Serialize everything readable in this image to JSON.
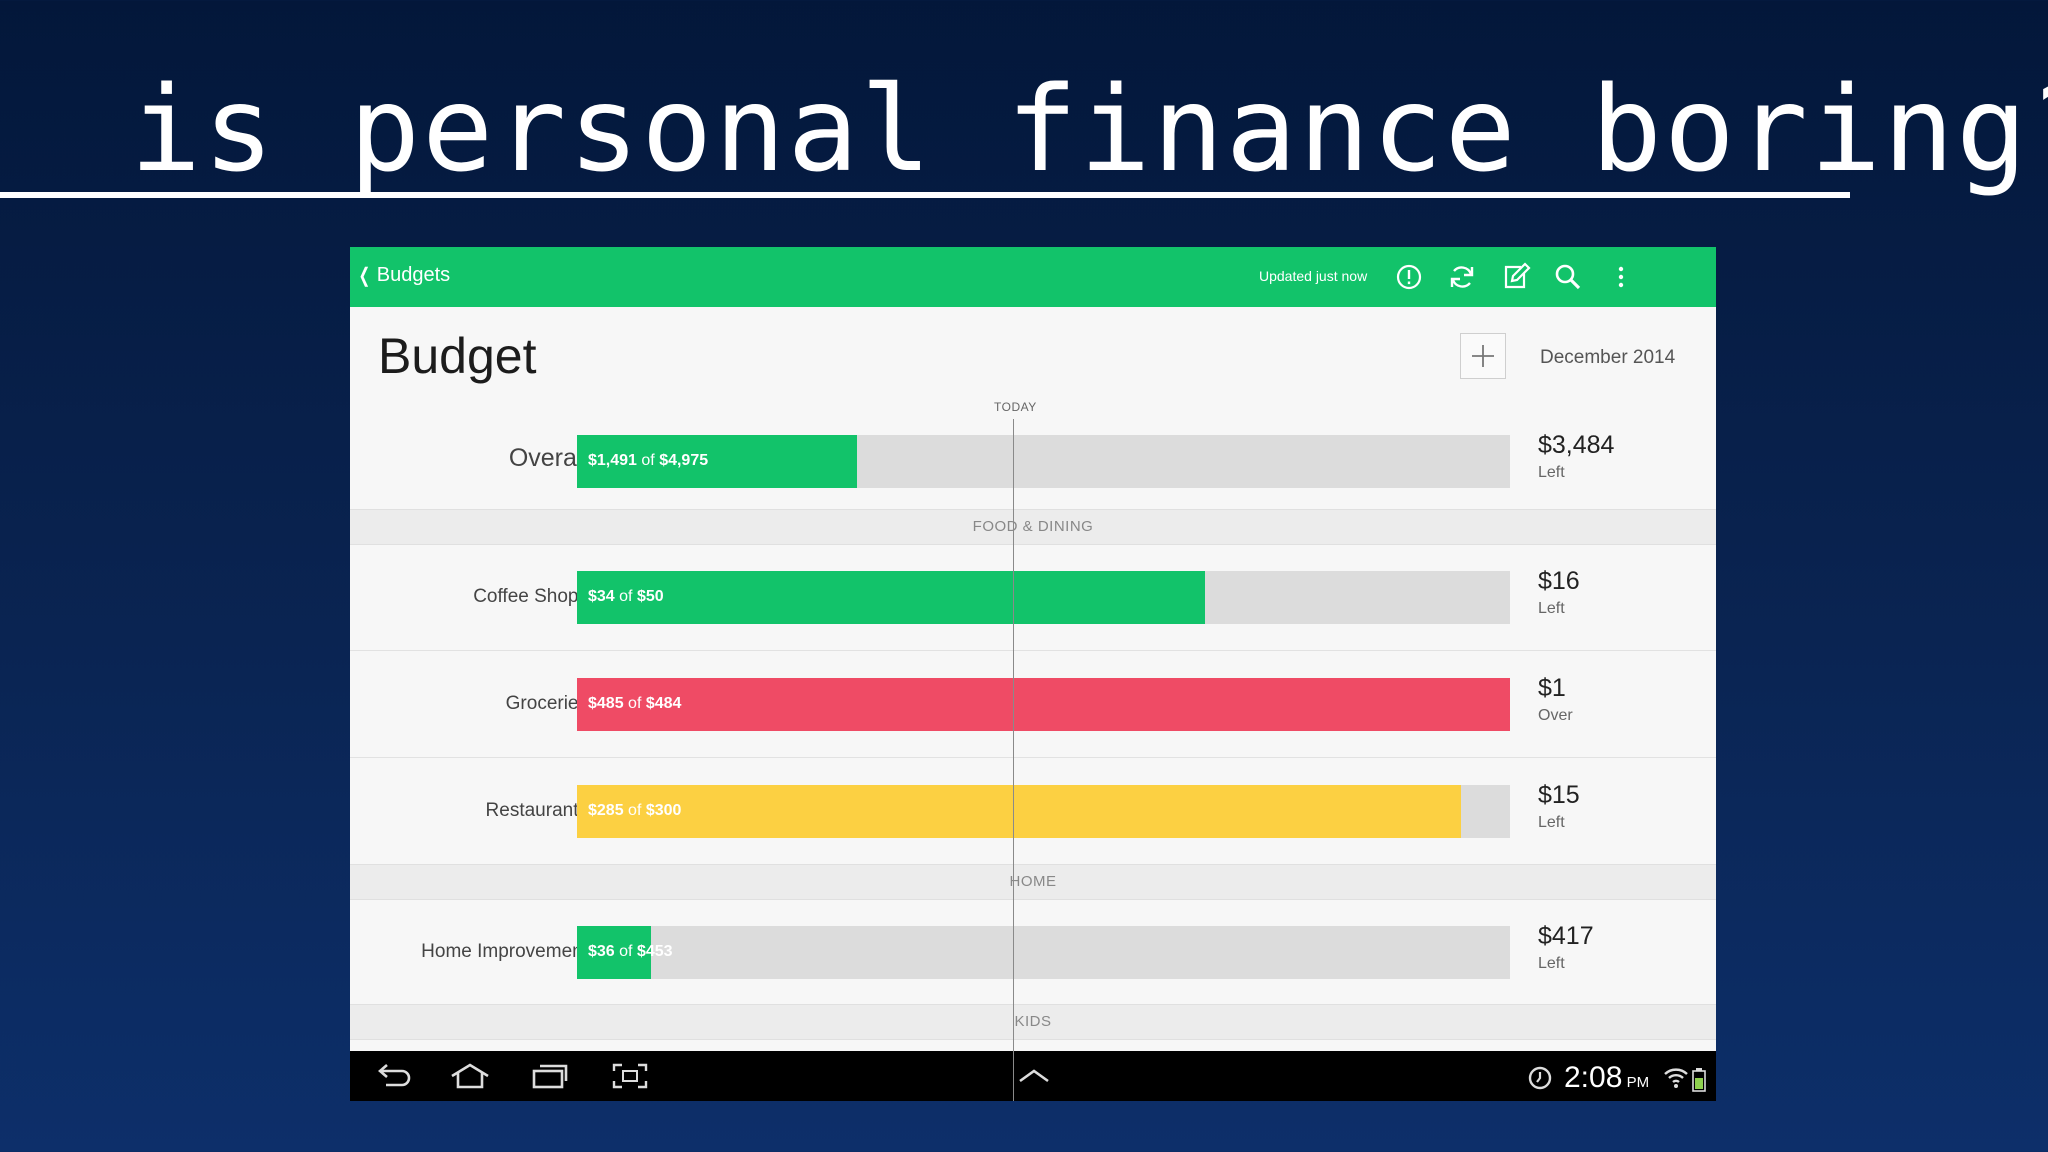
{
  "slide": {
    "title": "is personal finance boring?"
  },
  "appbar": {
    "back_label": "Budgets",
    "status": "Updated just now",
    "icons": [
      "alert-icon",
      "refresh-icon",
      "edit-icon",
      "search-icon",
      "more-icon"
    ]
  },
  "header": {
    "title": "Budget",
    "month": "December 2014",
    "today_label": "TODAY"
  },
  "overall": {
    "label": "Overall",
    "spent": "$1,491",
    "of": "of",
    "budget": "$4,975",
    "fraction": 0.3,
    "color": "#12c36a",
    "remaining": "$3,484",
    "status": "Left"
  },
  "sections": [
    {
      "name": "FOOD & DINING"
    },
    {
      "name": "HOME"
    },
    {
      "name": "KIDS"
    }
  ],
  "budgets": [
    {
      "label": "Coffee Shops",
      "spent": "$34",
      "of": "of",
      "budget": "$50",
      "fraction": 0.673,
      "color": "#12c36a",
      "remaining": "$16",
      "status": "Left"
    },
    {
      "label": "Groceries",
      "spent": "$485",
      "of": "of",
      "budget": "$484",
      "fraction": 1.0,
      "color": "#ef4b65",
      "remaining": "$1",
      "status": "Over"
    },
    {
      "label": "Restaurants",
      "spent": "$285",
      "of": "of",
      "budget": "$300",
      "fraction": 0.947,
      "color": "#fcd042",
      "remaining": "$15",
      "status": "Left"
    },
    {
      "label": "Home Improvement",
      "spent": "$36",
      "of": "of",
      "budget": "$453",
      "fraction": 0.079,
      "color": "#12c36a",
      "remaining": "$417",
      "status": "Left"
    }
  ],
  "system_bar": {
    "time": "2:08",
    "ampm": "PM",
    "icons": [
      "back-icon",
      "home-icon",
      "recent-apps-icon",
      "screenshot-icon",
      "chevron-up-icon",
      "alarm-icon",
      "wifi-icon",
      "battery-icon"
    ]
  },
  "colors": {
    "brand": "#12c36a",
    "over": "#ef4b65",
    "warning": "#fcd042",
    "track": "#dcdcdc"
  }
}
